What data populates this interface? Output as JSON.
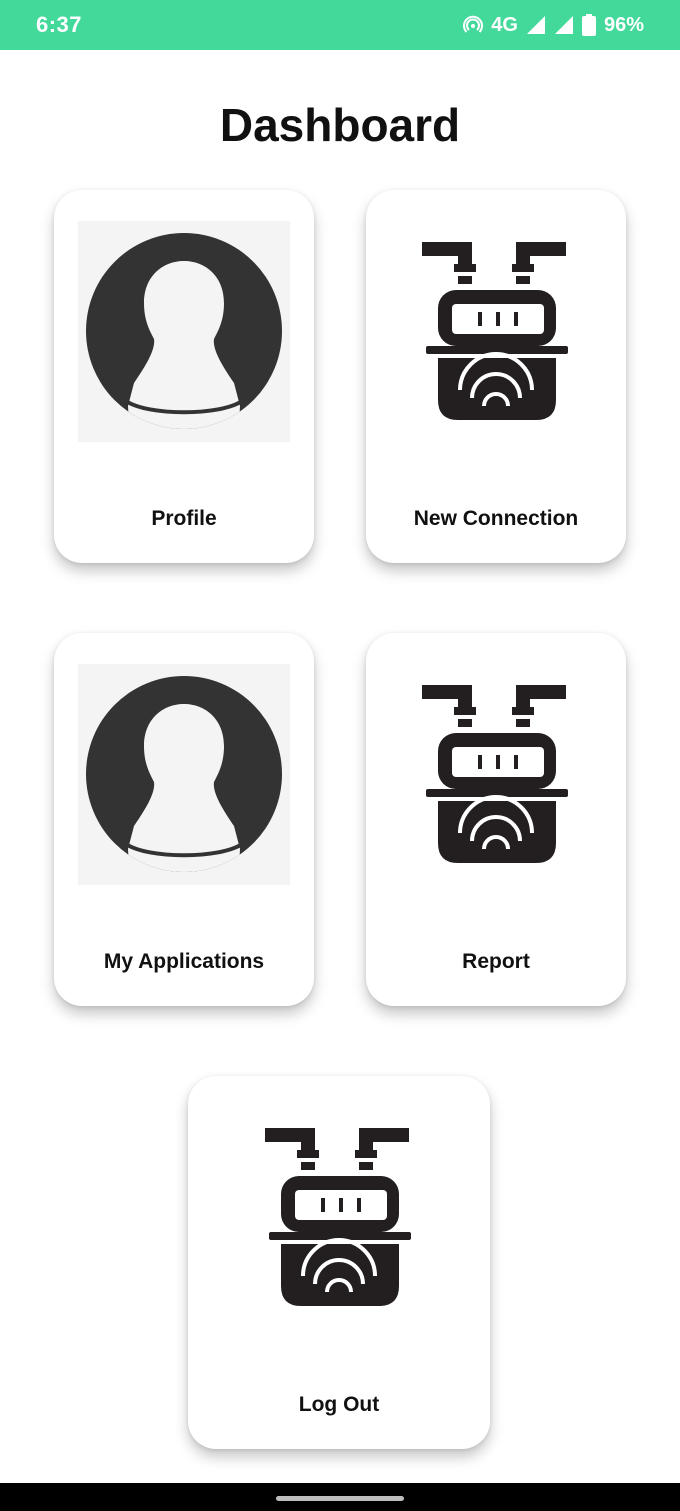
{
  "status_bar": {
    "time": "6:37",
    "network": "4G",
    "battery": "96%",
    "color": "#43d99a"
  },
  "title": "Dashboard",
  "cards": [
    {
      "label": "Profile",
      "icon": "user-avatar-icon"
    },
    {
      "label": "New Connection",
      "icon": "gas-meter-icon"
    },
    {
      "label": "My Applications",
      "icon": "user-avatar-icon"
    },
    {
      "label": "Report",
      "icon": "gas-meter-icon"
    },
    {
      "label": "Log Out",
      "icon": "gas-meter-icon"
    }
  ]
}
